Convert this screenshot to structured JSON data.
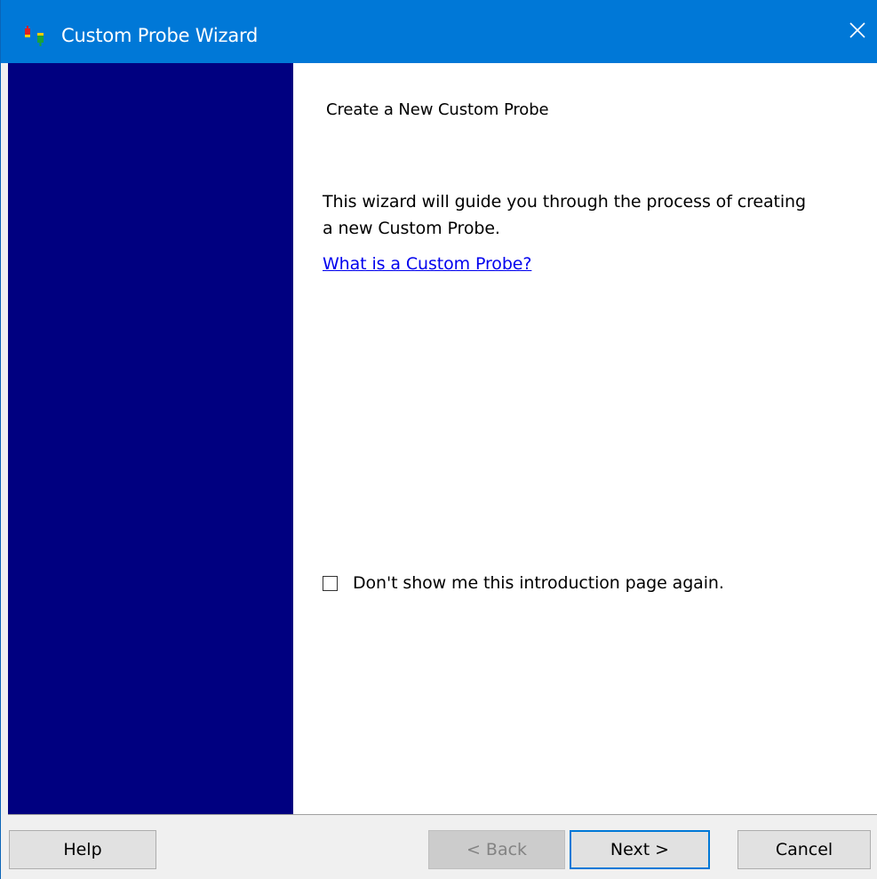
{
  "window": {
    "title": "Custom Probe Wizard",
    "icon": "probe-app-icon",
    "close_icon": "close-icon"
  },
  "colors": {
    "titlebar": "#0078d7",
    "sidebar": "#000080",
    "content": "#ffffff",
    "link": "#0000ee"
  },
  "content": {
    "heading": "Create a New Custom Probe",
    "intro": "This wizard will guide you through the process of creating a new Custom Probe.",
    "link_text": "What is a Custom Probe?",
    "checkbox_label": "Don't show me this introduction page again.",
    "checkbox_checked": false
  },
  "buttons": {
    "help": "Help",
    "back": "< Back",
    "next": "Next >",
    "cancel": "Cancel"
  }
}
